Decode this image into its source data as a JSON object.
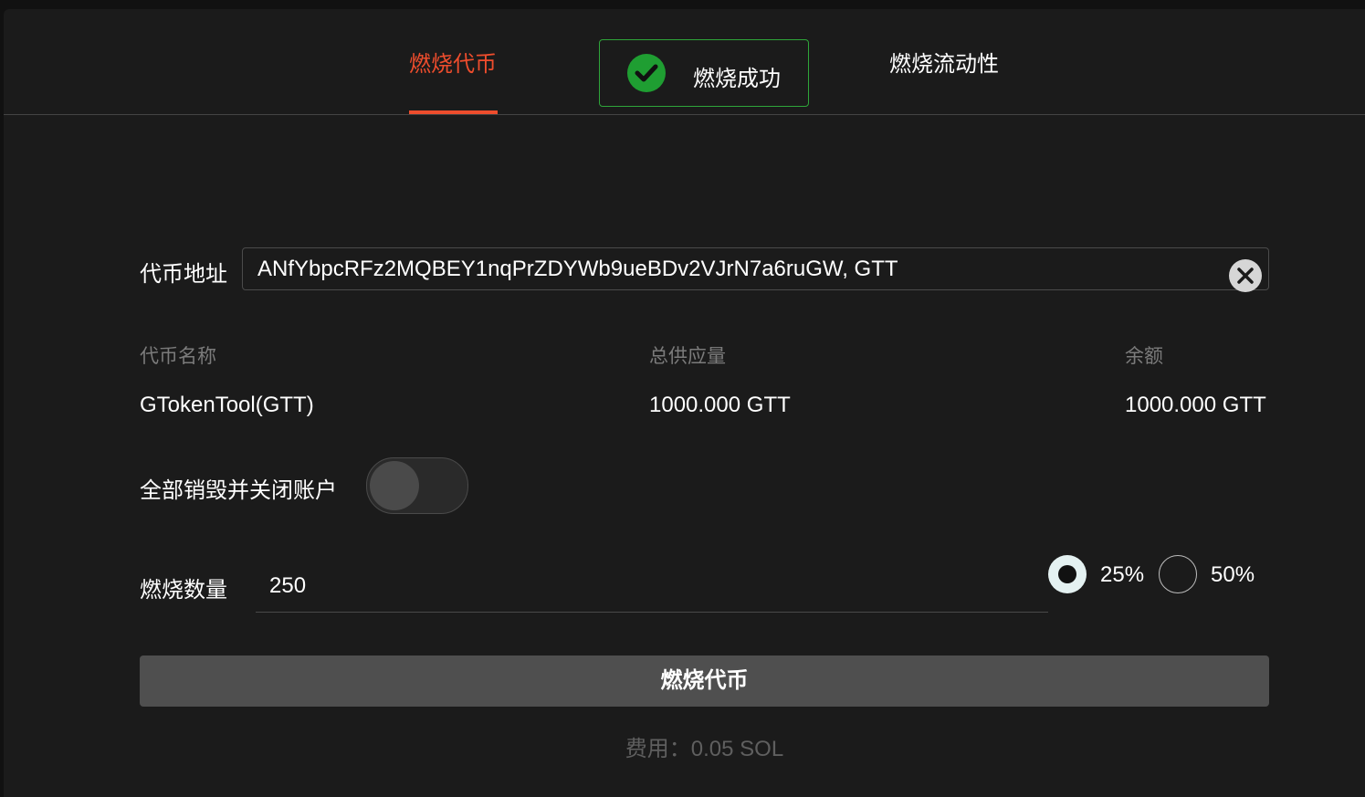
{
  "tabs": [
    {
      "label": "燃烧代币",
      "active": true
    },
    {
      "label": "燃烧流动性",
      "active": false
    }
  ],
  "toast": {
    "message": "燃烧成功",
    "icon": "check-circle-icon",
    "color": "#2fa53a"
  },
  "form": {
    "address_label": "代币地址",
    "address_value": "ANfYbpcRFz2MQBEY1nqPrZDYWb9ueBDv2VJrN7a6ruGW, GTT",
    "clear_icon": "close-circle-icon",
    "info": {
      "name_header": "代币名称",
      "name_value": "GTokenTool(GTT)",
      "supply_header": "总供应量",
      "supply_value": "1000.000 GTT",
      "balance_header": "余额",
      "balance_value": "1000.000 GTT"
    },
    "close_account_label": "全部销毁并关闭账户",
    "close_account_enabled": false,
    "amount_label": "燃烧数量",
    "amount_value": "250",
    "percent_options": [
      {
        "label": "25%",
        "selected": true
      },
      {
        "label": "50%",
        "selected": false
      }
    ],
    "submit_label": "燃烧代币",
    "fee_text": "费用：0.05 SOL"
  },
  "colors": {
    "accent": "#ee4d2d",
    "success": "#2fa53a",
    "background": "#1b1b1b",
    "button": "#4f4f4f"
  }
}
